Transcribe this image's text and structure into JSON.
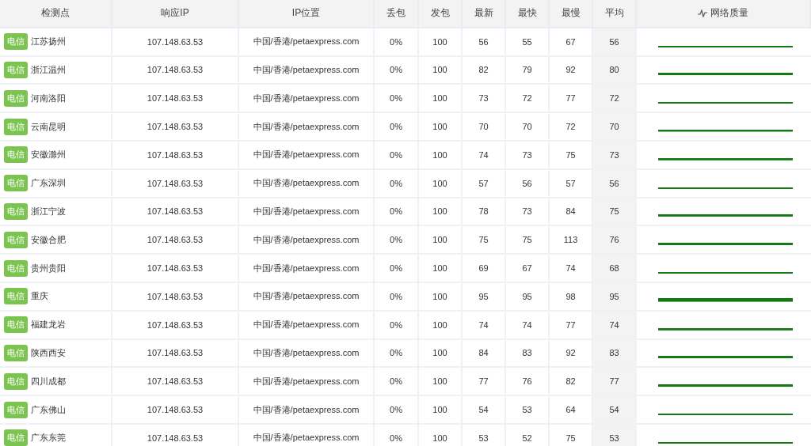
{
  "table": {
    "columns": [
      "检测点",
      "响应IP",
      "IP位置",
      "丢包",
      "发包",
      "最新",
      "最快",
      "最慢",
      "平均",
      "网络质量"
    ],
    "rows": [
      {
        "isp": "电信",
        "location": "江苏扬州",
        "ip": "107.148.63.53",
        "ip_location": "中国/香港/petaexpress.com",
        "loss": "0%",
        "sent": "100",
        "latest": "56",
        "fastest": "55",
        "slowest": "67",
        "average": "56"
      },
      {
        "isp": "电信",
        "location": "浙江温州",
        "ip": "107.148.63.53",
        "ip_location": "中国/香港/petaexpress.com",
        "loss": "0%",
        "sent": "100",
        "latest": "82",
        "fastest": "79",
        "slowest": "92",
        "average": "80"
      },
      {
        "isp": "电信",
        "location": "河南洛阳",
        "ip": "107.148.63.53",
        "ip_location": "中国/香港/petaexpress.com",
        "loss": "0%",
        "sent": "100",
        "latest": "73",
        "fastest": "72",
        "slowest": "77",
        "average": "72"
      },
      {
        "isp": "电信",
        "location": "云南昆明",
        "ip": "107.148.63.53",
        "ip_location": "中国/香港/petaexpress.com",
        "loss": "0%",
        "sent": "100",
        "latest": "70",
        "fastest": "70",
        "slowest": "72",
        "average": "70"
      },
      {
        "isp": "电信",
        "location": "安徽滁州",
        "ip": "107.148.63.53",
        "ip_location": "中国/香港/petaexpress.com",
        "loss": "0%",
        "sent": "100",
        "latest": "74",
        "fastest": "73",
        "slowest": "75",
        "average": "73"
      },
      {
        "isp": "电信",
        "location": "广东深圳",
        "ip": "107.148.63.53",
        "ip_location": "中国/香港/petaexpress.com",
        "loss": "0%",
        "sent": "100",
        "latest": "57",
        "fastest": "56",
        "slowest": "57",
        "average": "56"
      },
      {
        "isp": "电信",
        "location": "浙江宁波",
        "ip": "107.148.63.53",
        "ip_location": "中国/香港/petaexpress.com",
        "loss": "0%",
        "sent": "100",
        "latest": "78",
        "fastest": "73",
        "slowest": "84",
        "average": "75"
      },
      {
        "isp": "电信",
        "location": "安徽合肥",
        "ip": "107.148.63.53",
        "ip_location": "中国/香港/petaexpress.com",
        "loss": "0%",
        "sent": "100",
        "latest": "75",
        "fastest": "75",
        "slowest": "113",
        "average": "76"
      },
      {
        "isp": "电信",
        "location": "贵州贵阳",
        "ip": "107.148.63.53",
        "ip_location": "中国/香港/petaexpress.com",
        "loss": "0%",
        "sent": "100",
        "latest": "69",
        "fastest": "67",
        "slowest": "74",
        "average": "68"
      },
      {
        "isp": "电信",
        "location": "重庆",
        "ip": "107.148.63.53",
        "ip_location": "中国/香港/petaexpress.com",
        "loss": "0%",
        "sent": "100",
        "latest": "95",
        "fastest": "95",
        "slowest": "98",
        "average": "95"
      },
      {
        "isp": "电信",
        "location": "福建龙岩",
        "ip": "107.148.63.53",
        "ip_location": "中国/香港/petaexpress.com",
        "loss": "0%",
        "sent": "100",
        "latest": "74",
        "fastest": "74",
        "slowest": "77",
        "average": "74"
      },
      {
        "isp": "电信",
        "location": "陕西西安",
        "ip": "107.148.63.53",
        "ip_location": "中国/香港/petaexpress.com",
        "loss": "0%",
        "sent": "100",
        "latest": "84",
        "fastest": "83",
        "slowest": "92",
        "average": "83"
      },
      {
        "isp": "电信",
        "location": "四川成都",
        "ip": "107.148.63.53",
        "ip_location": "中国/香港/petaexpress.com",
        "loss": "0%",
        "sent": "100",
        "latest": "77",
        "fastest": "76",
        "slowest": "82",
        "average": "77"
      },
      {
        "isp": "电信",
        "location": "广东佛山",
        "ip": "107.148.63.53",
        "ip_location": "中国/香港/petaexpress.com",
        "loss": "0%",
        "sent": "100",
        "latest": "54",
        "fastest": "53",
        "slowest": "64",
        "average": "54"
      },
      {
        "isp": "电信",
        "location": "广东东莞",
        "ip": "107.148.63.53",
        "ip_location": "中国/香港/petaexpress.com",
        "loss": "0%",
        "sent": "100",
        "latest": "53",
        "fastest": "52",
        "slowest": "75",
        "average": "53"
      }
    ]
  }
}
